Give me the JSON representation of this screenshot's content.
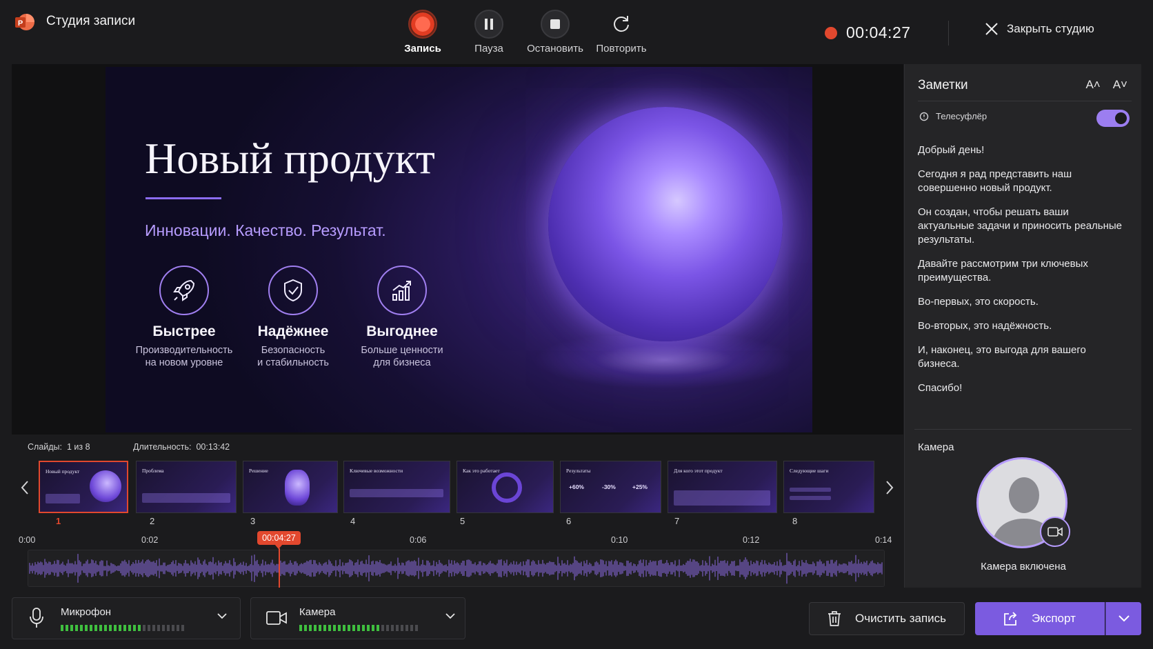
{
  "app": {
    "title": "Студия записи"
  },
  "controls": {
    "record": "Запись",
    "pause": "Пауза",
    "stop": "Остановить",
    "retake": "Повторить"
  },
  "recording": {
    "timer": "00:04:27"
  },
  "close_label": "Закрыть студию",
  "slide": {
    "title": "Новый продукт",
    "subtitle": "Инновации. Качество. Результат.",
    "features": [
      {
        "title": "Быстрее",
        "desc1": "Производительность",
        "desc2": "на новом уровне"
      },
      {
        "title": "Надёжнее",
        "desc1": "Безопасность",
        "desc2": "и стабильность"
      },
      {
        "title": "Выгоднее",
        "desc1": "Больше ценности",
        "desc2": "для бизнеса"
      }
    ]
  },
  "notes": {
    "title": "Заметки",
    "font_increase": "A˄",
    "font_decrease": "A˅",
    "teleprompter_label": "Телесуфлёр",
    "teleprompter_on": true,
    "paragraphs": [
      "Добрый день!",
      "Сегодня я рад представить наш совершенно новый продукт.",
      "Он создан, чтобы решать ваши актуальные задачи и приносить реальные результаты.",
      "Давайте рассмотрим три ключевых преимущества.",
      "Во-первых, это скорость.",
      "Во-вторых, это надёжность.",
      "И, наконец, это выгода для вашего бизнеса.",
      "Спасибо!"
    ]
  },
  "camera_panel": {
    "title": "Камера",
    "status": "Камера включена"
  },
  "slides_strip": {
    "count_label": "Слайды:",
    "count_value": "1 из 8",
    "duration_label": "Длительность:",
    "duration_value": "00:13:42",
    "thumbs": [
      {
        "num": "1",
        "title": "Новый продукт"
      },
      {
        "num": "2",
        "title": "Проблема"
      },
      {
        "num": "3",
        "title": "Решение"
      },
      {
        "num": "4",
        "title": "Ключевые возможности"
      },
      {
        "num": "5",
        "title": "Как это работает"
      },
      {
        "num": "6",
        "title": "Результаты",
        "stats": [
          "+60%",
          "-30%",
          "+25%"
        ]
      },
      {
        "num": "7",
        "title": "Для кого этот продукт"
      },
      {
        "num": "8",
        "title": "Следующие шаги"
      }
    ]
  },
  "timeline": {
    "ticks": [
      "0:00",
      "0:02",
      "0:06",
      "0:10",
      "0:12",
      "0:14"
    ],
    "playhead": "00:04:27"
  },
  "devices": {
    "microphone": {
      "label": "Микрофон",
      "level": 0.66
    },
    "camera": {
      "label": "Камера",
      "level": 0.69
    }
  },
  "actions": {
    "clear": "Очистить запись",
    "export": "Экспорт"
  },
  "colors": {
    "accent": "#7b5be0",
    "record": "#e2482e",
    "meter": "#3fbf3f",
    "panel": "#252527"
  }
}
